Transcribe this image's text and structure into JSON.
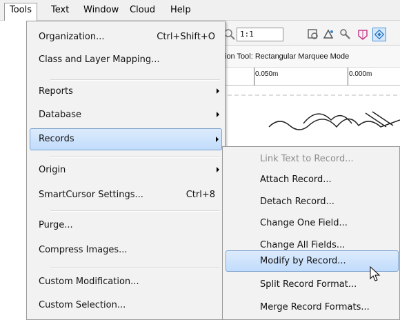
{
  "menubar": {
    "items": [
      "Tools",
      "Text",
      "Window",
      "Cloud",
      "Help"
    ]
  },
  "background": {
    "zoom_value": "1:1",
    "mode_text": "ion Tool: Rectangular Marquee Mode",
    "ruler_ticks": [
      "0.050m",
      "0.000m"
    ]
  },
  "tools_menu": {
    "items": [
      {
        "label": "Organization...",
        "shortcut": "Ctrl+Shift+O"
      },
      {
        "label": "Class and Layer Mapping..."
      },
      {
        "label": "Reports"
      },
      {
        "label": "Database"
      },
      {
        "label": "Records"
      },
      {
        "label": "Origin"
      },
      {
        "label": "SmartCursor Settings...",
        "shortcut": "Ctrl+8"
      },
      {
        "label": "Purge..."
      },
      {
        "label": "Compress Images..."
      },
      {
        "label": "Custom Modification..."
      },
      {
        "label": "Custom Selection..."
      }
    ]
  },
  "records_submenu": {
    "items": [
      {
        "label": "Link Text to Record..."
      },
      {
        "label": "Attach Record..."
      },
      {
        "label": "Detach Record..."
      },
      {
        "label": "Change One Field..."
      },
      {
        "label": "Change All Fields..."
      },
      {
        "label": "Modify by Record..."
      },
      {
        "label": "Split Record Format..."
      },
      {
        "label": "Merge Record Formats..."
      }
    ]
  },
  "colors": {
    "highlight": "#c1dcfc",
    "highlight_border": "#7da2ce",
    "menu_bg": "#f2f2f2",
    "disabled_text": "#8c8c8c"
  }
}
